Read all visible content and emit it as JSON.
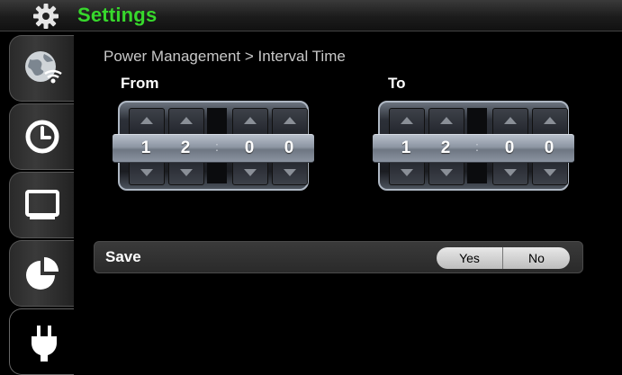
{
  "titlebar": {
    "title": "Settings",
    "icon": "gear-icon"
  },
  "sidebar": {
    "tabs": [
      {
        "icon": "globe-network-icon",
        "active": false
      },
      {
        "icon": "clock-icon",
        "active": false
      },
      {
        "icon": "display-icon",
        "active": false
      },
      {
        "icon": "pie-chart-icon",
        "active": false
      },
      {
        "icon": "power-plug-icon",
        "active": true
      }
    ]
  },
  "main": {
    "breadcrumb": "Power Management > Interval Time",
    "from": {
      "label": "From",
      "digits": [
        "1",
        "2",
        "0",
        "0"
      ],
      "separator": ":"
    },
    "to": {
      "label": "To",
      "digits": [
        "1",
        "2",
        "0",
        "0"
      ],
      "separator": ":"
    },
    "save": {
      "label": "Save",
      "yes_label": "Yes",
      "no_label": "No"
    }
  },
  "colors": {
    "title_accent": "#37d82c"
  }
}
